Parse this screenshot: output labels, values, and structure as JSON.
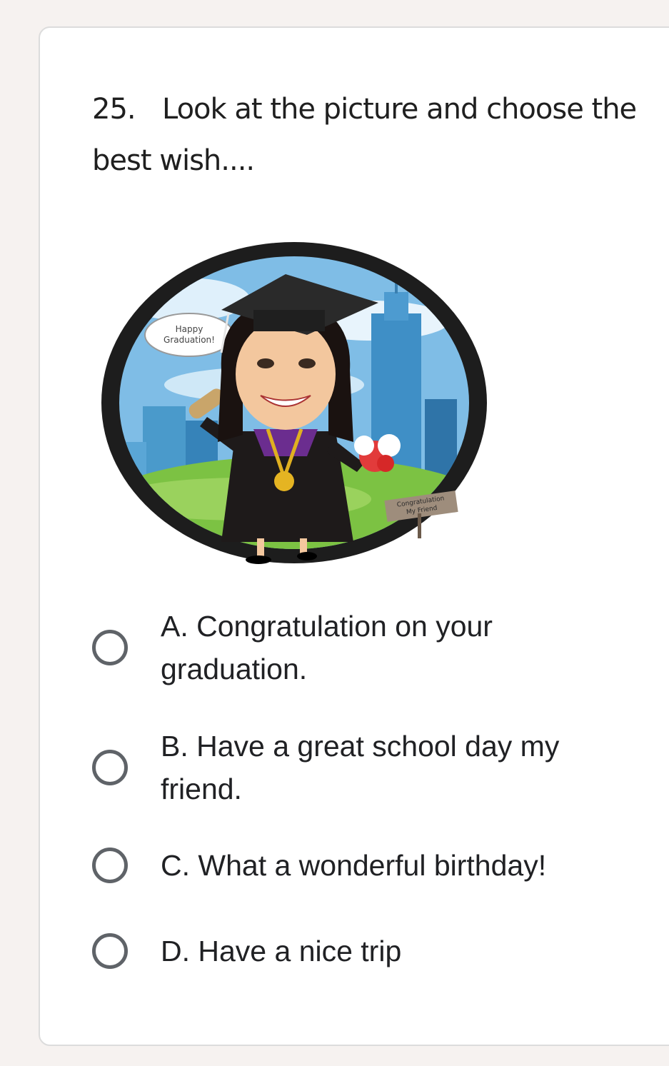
{
  "question": {
    "number": "25.",
    "text": "Look at the picture and choose the best wish...."
  },
  "illustration": {
    "bubble_text": "Happy Graduation!",
    "sign_text": "Congratulation My Friend"
  },
  "options": [
    {
      "label": "A. Congratulation on your graduation.",
      "selected": false
    },
    {
      "label": "B. Have a great school day my friend.",
      "selected": false
    },
    {
      "label": "C. What a wonderful birthday!",
      "selected": false
    },
    {
      "label": "D. Have a nice trip",
      "selected": false
    }
  ],
  "colors": {
    "page_bg": "#f6f2f0",
    "card_bg": "#ffffff",
    "radio_border": "#5f6368",
    "text": "#202124"
  }
}
